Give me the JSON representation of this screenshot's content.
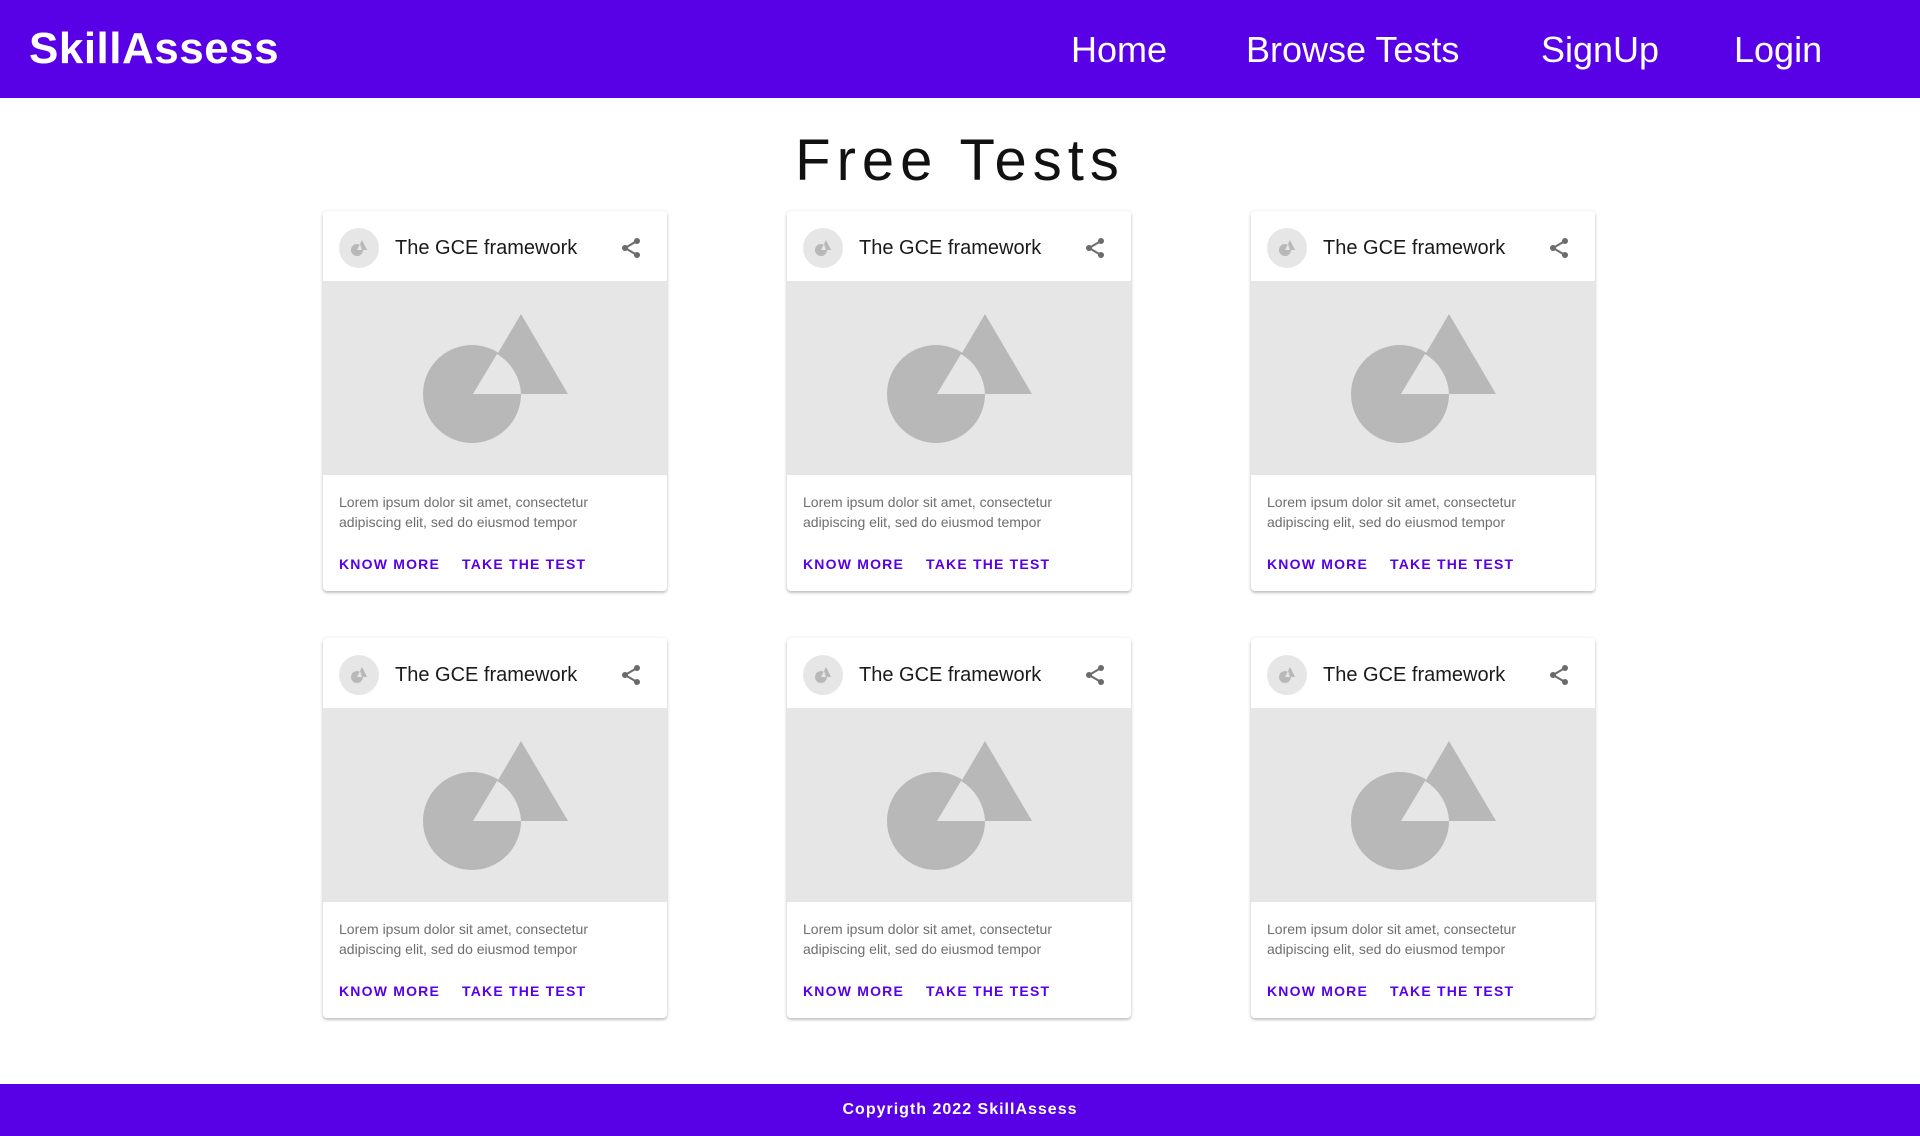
{
  "navbar": {
    "brand": "SkillAssess",
    "links": [
      "Home",
      "Browse Tests",
      "SignUp",
      "Login"
    ],
    "background": "#5800e6"
  },
  "main": {
    "title": "Free Tests",
    "cards": [
      {
        "title": "The GCE framework",
        "description": "Lorem ipsum dolor sit amet, consectetur adipiscing elit, sed do eiusmod tempor",
        "know_more": "KNOW MORE",
        "take_test": "TAKE THE TEST",
        "avatar_icon": "shapes-icon",
        "share_icon": "share-icon",
        "media_icon": "image-placeholder-icon"
      },
      {
        "title": "The GCE framework",
        "description": "Lorem ipsum dolor sit amet, consectetur adipiscing elit, sed do eiusmod tempor",
        "know_more": "KNOW MORE",
        "take_test": "TAKE THE TEST",
        "avatar_icon": "shapes-icon",
        "share_icon": "share-icon",
        "media_icon": "image-placeholder-icon"
      },
      {
        "title": "The GCE framework",
        "description": "Lorem ipsum dolor sit amet, consectetur adipiscing elit, sed do eiusmod tempor",
        "know_more": "KNOW MORE",
        "take_test": "TAKE THE TEST",
        "avatar_icon": "shapes-icon",
        "share_icon": "share-icon",
        "media_icon": "image-placeholder-icon"
      },
      {
        "title": "The GCE framework",
        "description": "Lorem ipsum dolor sit amet, consectetur adipiscing elit, sed do eiusmod tempor",
        "know_more": "KNOW MORE",
        "take_test": "TAKE THE TEST",
        "avatar_icon": "shapes-icon",
        "share_icon": "share-icon",
        "media_icon": "image-placeholder-icon"
      },
      {
        "title": "The GCE framework",
        "description": "Lorem ipsum dolor sit amet, consectetur adipiscing elit, sed do eiusmod tempor",
        "know_more": "KNOW MORE",
        "take_test": "TAKE THE TEST",
        "avatar_icon": "shapes-icon",
        "share_icon": "share-icon",
        "media_icon": "image-placeholder-icon"
      },
      {
        "title": "The GCE framework",
        "description": "Lorem ipsum dolor sit amet, consectetur adipiscing elit, sed do eiusmod tempor",
        "know_more": "KNOW MORE",
        "take_test": "TAKE THE TEST",
        "avatar_icon": "shapes-icon",
        "share_icon": "share-icon",
        "media_icon": "image-placeholder-icon"
      }
    ]
  },
  "footer": {
    "text": "Copyrigth 2022 SkillAssess"
  },
  "colors": {
    "accent": "#5800e6",
    "placeholder_bg": "#e6e6e6",
    "placeholder_shape": "#b8b8b8"
  }
}
